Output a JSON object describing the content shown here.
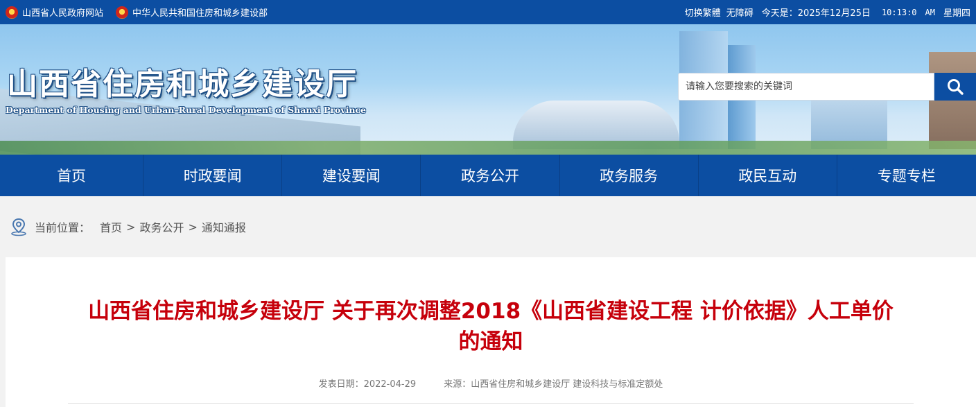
{
  "topbar": {
    "links": [
      {
        "label": "山西省人民政府网站",
        "icon": "emblem-icon"
      },
      {
        "label": "中华人民共和国住房和城乡建设部",
        "icon": "emblem-icon"
      }
    ],
    "switch_label": "切换繁體",
    "accessibility_label": "无障碍",
    "today_label": "今天是：2025年12月25日",
    "time": "10:13:0",
    "ampm": "AM",
    "weekday": "星期四"
  },
  "banner": {
    "title": "山西省住房和城乡建设厅",
    "subtitle": "Department of Housing and Urban–Rural Development of Shanxi Province"
  },
  "search": {
    "placeholder": "请输入您要搜索的关键词",
    "icon": "search-icon"
  },
  "nav": {
    "items": [
      "首页",
      "时政要闻",
      "建设要闻",
      "政务公开",
      "政务服务",
      "政民互动",
      "专题专栏"
    ]
  },
  "breadcrumb": {
    "label": "当前位置：",
    "items": [
      "首页",
      "政务公开",
      "通知通报"
    ],
    "separator": ">",
    "icon": "location-icon"
  },
  "article": {
    "title": "山西省住房和城乡建设厅 关于再次调整2018《山西省建设工程 计价依据》人工单价的通知",
    "date_label": "发表日期：",
    "date": "2022-04-29",
    "source_label": "来源：",
    "source": "山西省住房和城乡建设厅 建设科技与标准定额处"
  },
  "colors": {
    "primary_blue": "#0c4ea2",
    "title_red": "#c6000b"
  }
}
